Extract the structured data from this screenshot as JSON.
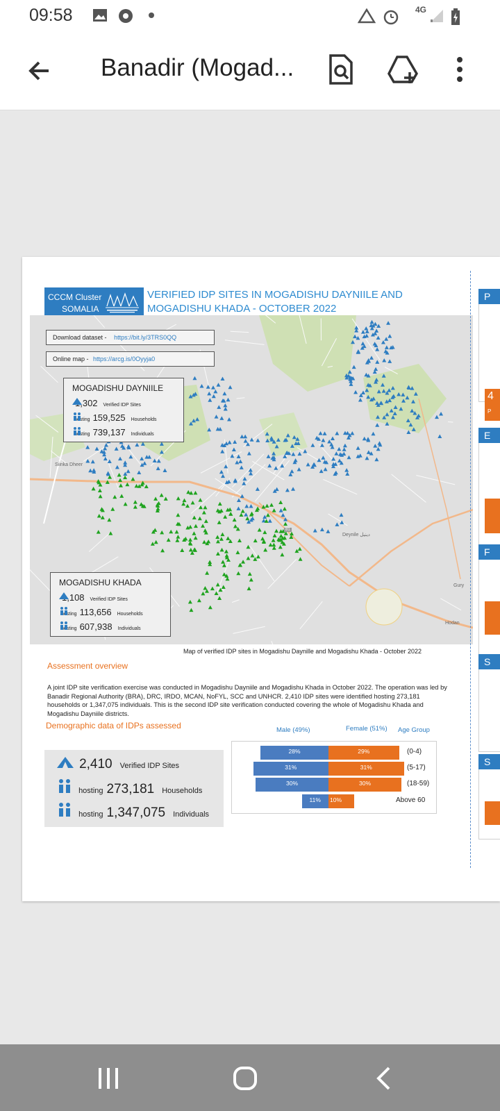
{
  "status_bar": {
    "time": "09:58",
    "network": "4G",
    "icons": [
      "image-icon",
      "chrome-icon",
      "dot-icon",
      "data-saver-icon",
      "alarm-icon",
      "signal-icon",
      "battery-charging-icon"
    ]
  },
  "app_bar": {
    "title": "Banadir (Mogad...",
    "icons": [
      "back-arrow-icon",
      "search-document-icon",
      "add-to-drive-icon",
      "more-vert-icon"
    ]
  },
  "document": {
    "logo": {
      "line1": "CCCM Cluster",
      "line2": "SOMALIA",
      "emblem_text": "CAMP COORDINATION AND CAMP MANAGEMENT"
    },
    "title": "VERIFIED IDP SITES IN MOGADISHU DAYNIILE AND MOGADISHU KHADA - OCTOBER 2022",
    "links": {
      "download_label": "Download dataset -",
      "download_url": "https://bit.ly/3TRS0QQ",
      "online_label": "Online map -",
      "online_url": "https://arcg.is/0Oyyja0"
    },
    "dayniile": {
      "title": "MOGADISHU DAYNIILE",
      "sites": "1,302",
      "sites_label": "Verified IDP Sites",
      "hosting_word": "hosting",
      "households": "159,525",
      "households_label": "Households",
      "individuals": "739,137",
      "individuals_label": "Individuals"
    },
    "khada": {
      "title": "MOGADISHU KHADA",
      "sites": "1,108",
      "sites_label": "Verified IDP Sites",
      "hosting_word": "hosting",
      "households": "113,656",
      "households_label": "Households",
      "individuals": "607,938",
      "individuals_label": "Individuals"
    },
    "map_labels": {
      "place_1": "Siinka Dheer",
      "place_2": "Deynile دينيل",
      "place_3": "Gury",
      "place_4": "Hodan",
      "road_1": "81"
    },
    "map_caption": "Map of verified IDP sites in Mogadishu Daynille and Mogadishu Khada - October 2022",
    "assessment_heading": "Assessment overview",
    "assessment_text": "A joint IDP site verification exercise was conducted in Mogadishu Dayniile and Mogadishu Khada in October 2022. The operation was led by Banadir Regional Authority (BRA),  DRC, IRDO, MCAN, NoFYL, SCC and UNHCR. 2,410 IDP sites were identified hosting 273,181 households or 1,347,075 individuals. This is the second IDP site verification conducted covering the whole of Mogadishu Khada and Mogadishu Dayniile districts.",
    "demographic_heading": "Demographic data of IDPs assessed",
    "totals": {
      "sites": "2,410",
      "sites_label": "Verified IDP Sites",
      "hosting_word": "hosting",
      "households": "273,181",
      "households_label": "Households",
      "individuals": "1,347,075",
      "individuals_label": "Individuals"
    },
    "side_tabs": [
      "P",
      "E",
      "F",
      "S",
      "S"
    ],
    "side_text_4": "4",
    "side_text_p": "P"
  },
  "chart_data": {
    "type": "bar",
    "orientation": "population-pyramid",
    "headers": {
      "male": "Male (49%)",
      "female": "Female (51%)",
      "age": "Age Group"
    },
    "categories": [
      "(0-4)",
      "(5-17)",
      "(18-59)",
      "Above 60"
    ],
    "series": [
      {
        "name": "Male (49%)",
        "values": [
          28,
          31,
          30,
          11
        ],
        "labels": [
          "28%",
          "31%",
          "30%",
          "11%"
        ],
        "color": "#4a7cc0"
      },
      {
        "name": "Female (51%)",
        "values": [
          29,
          31,
          30,
          10
        ],
        "labels": [
          "29%",
          "31%",
          "30%",
          "10%"
        ],
        "color": "#e8711f"
      }
    ]
  },
  "colors": {
    "dayniile_sites": "#2e7dc1",
    "khada_sites": "#1fa31f",
    "accent_orange": "#e8711f"
  }
}
